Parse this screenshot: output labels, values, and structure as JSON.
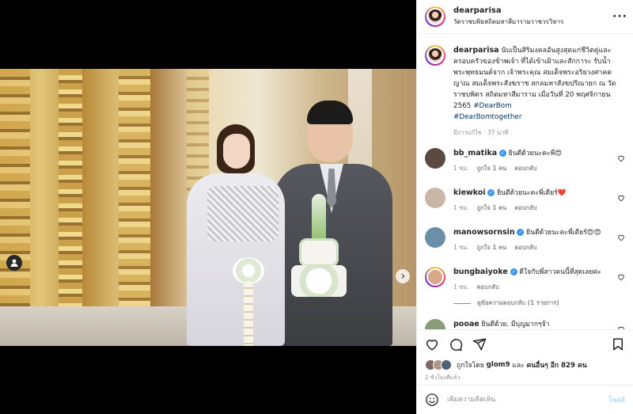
{
  "header": {
    "username": "dearparisa",
    "location": "วัดราชบพิธสถิตมหาสีมารามราชวรวิหาร",
    "more_label": "···"
  },
  "caption": {
    "username": "dearparisa",
    "text": "นับเป็นสิริมงคลอันสูงสุดแก่ชีวิตคู่และครอบครัวของข้าพเจ้า ที่ได้เข้าเฝ้าและสักการะ รับน้ำพระพุทธมนต์จาก เจ้าพระคุณ สมเด็จพระอริยวงศาคตญาณ สมเด็จพระสังฆราช สกลมหาสังฆปริณายก ณ วัดราชบพิตร สถิตมหาสีมาราม เมื่อวันที่ 20 พฤศจิกายน 2565",
    "hashtag1": "#DearBom",
    "hashtag2": "#DearBomtogether",
    "meta": "มีการแก้ไข · 37 นาที"
  },
  "comments": [
    {
      "username": "bb_matika",
      "text": "ยินดีด้วยนะคะพี่😍",
      "time": "1 ชม.",
      "likes": "ถูกใจ 1 คน",
      "reply": "ตอบกลับ",
      "avatar_color": "#5b4a42"
    },
    {
      "username": "kiewkoi",
      "text": "ยินดีด้วยนะคะพี่เดียร์❤️",
      "time": "1 ชม.",
      "likes": "ถูกใจ 1 คน",
      "reply": "ตอบกลับ",
      "avatar_color": "#c9b6a6"
    },
    {
      "username": "manowsornsin",
      "text": "ยินดีด้วยนะคะพี่เดียร์😍😍",
      "time": "1 ชม.",
      "likes": "ถูกใจ 1 คน",
      "reply": "ตอบกลับ",
      "avatar_color": "#6b8fa8"
    },
    {
      "username": "bungbaiyoke",
      "text": "ดีใจกับพี่สาวคนนี้ที่สุดเลยค่ะ",
      "time": "1 ชม.",
      "likes": "",
      "reply": "ตอบกลับ",
      "avatar_color": "#d7a88a"
    },
    {
      "username": "pooae",
      "text": "ยินดีด้วย. มีบุญมากๆจ้า",
      "time": "",
      "likes": "",
      "reply": "",
      "avatar_color": "#8a9b7a"
    }
  ],
  "view_replies_label": "ดูข้อความตอบกลับ (1 รายการ)",
  "likes": {
    "text_prefix": "ถูกใจโดย",
    "user": "glom9",
    "text_mid": "และ",
    "others": "คนอื่นๆ อีก 829 คน"
  },
  "posted_time": "2 ชั่วโมงที่แล้ว",
  "add_comment": {
    "placeholder": "เพิ่มความคิดเห็น",
    "post_label": "โพสต์"
  },
  "media": {
    "total_slides": 5,
    "current_slide": 1
  },
  "colors": {
    "link": "#00376b",
    "verified": "#3897f0",
    "muted": "#8e8e8e",
    "post_disabled": "#b2dffc"
  }
}
